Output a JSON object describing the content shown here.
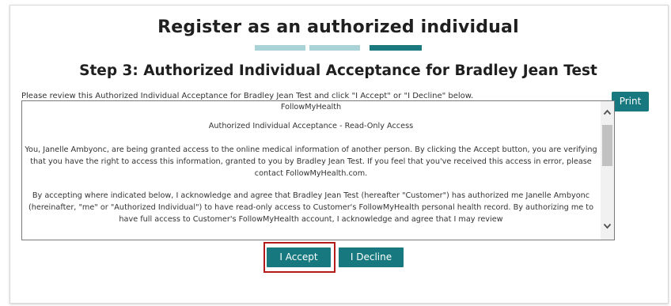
{
  "colors": {
    "teal": "#17797f",
    "progress_light": "#a9d3d6",
    "progress_active": "#1a7a80",
    "highlight": "#b31b1b",
    "text": "#333333"
  },
  "header": {
    "title": "Register as an authorized individual",
    "step_title": "Step 3: Authorized Individual Acceptance for Bradley Jean Test"
  },
  "progress": {
    "steps_total": 3,
    "current_step": 3
  },
  "instructions": "Please review this Authorized Individual Acceptance for Bradley Jean Test and click \"I Accept\" or \"I Decline\" below.",
  "print_label": "Print",
  "document": {
    "heading": "FollowMyHealth",
    "subheading": "Authorized Individual Acceptance - Read-Only Access",
    "paragraph1": "You, Janelle Ambyonc, are being granted access to the online medical information of another person.  By clicking the Accept button, you are verifying that you have the right to access this information, granted to you by Bradley Jean Test.  If you feel that you've received this access in error, please contact FollowMyHealth.com.",
    "paragraph2": "By accepting where indicated below, I acknowledge and agree that Bradley Jean Test (hereafter \"Customer\") has authorized me Janelle Ambyonc (hereinafter, \"me\" or \"Authorized Individual\") to have read-only access to Customer's FollowMyHealth personal health record.  By authorizing me to have full access to Customer's FollowMyHealth account,  I acknowledge and agree that I may review"
  },
  "scrollbar": {
    "up_icon": "chevron-up-icon",
    "down_icon": "chevron-down-icon"
  },
  "actions": {
    "accept_label": "I Accept",
    "decline_label": "I Decline"
  }
}
